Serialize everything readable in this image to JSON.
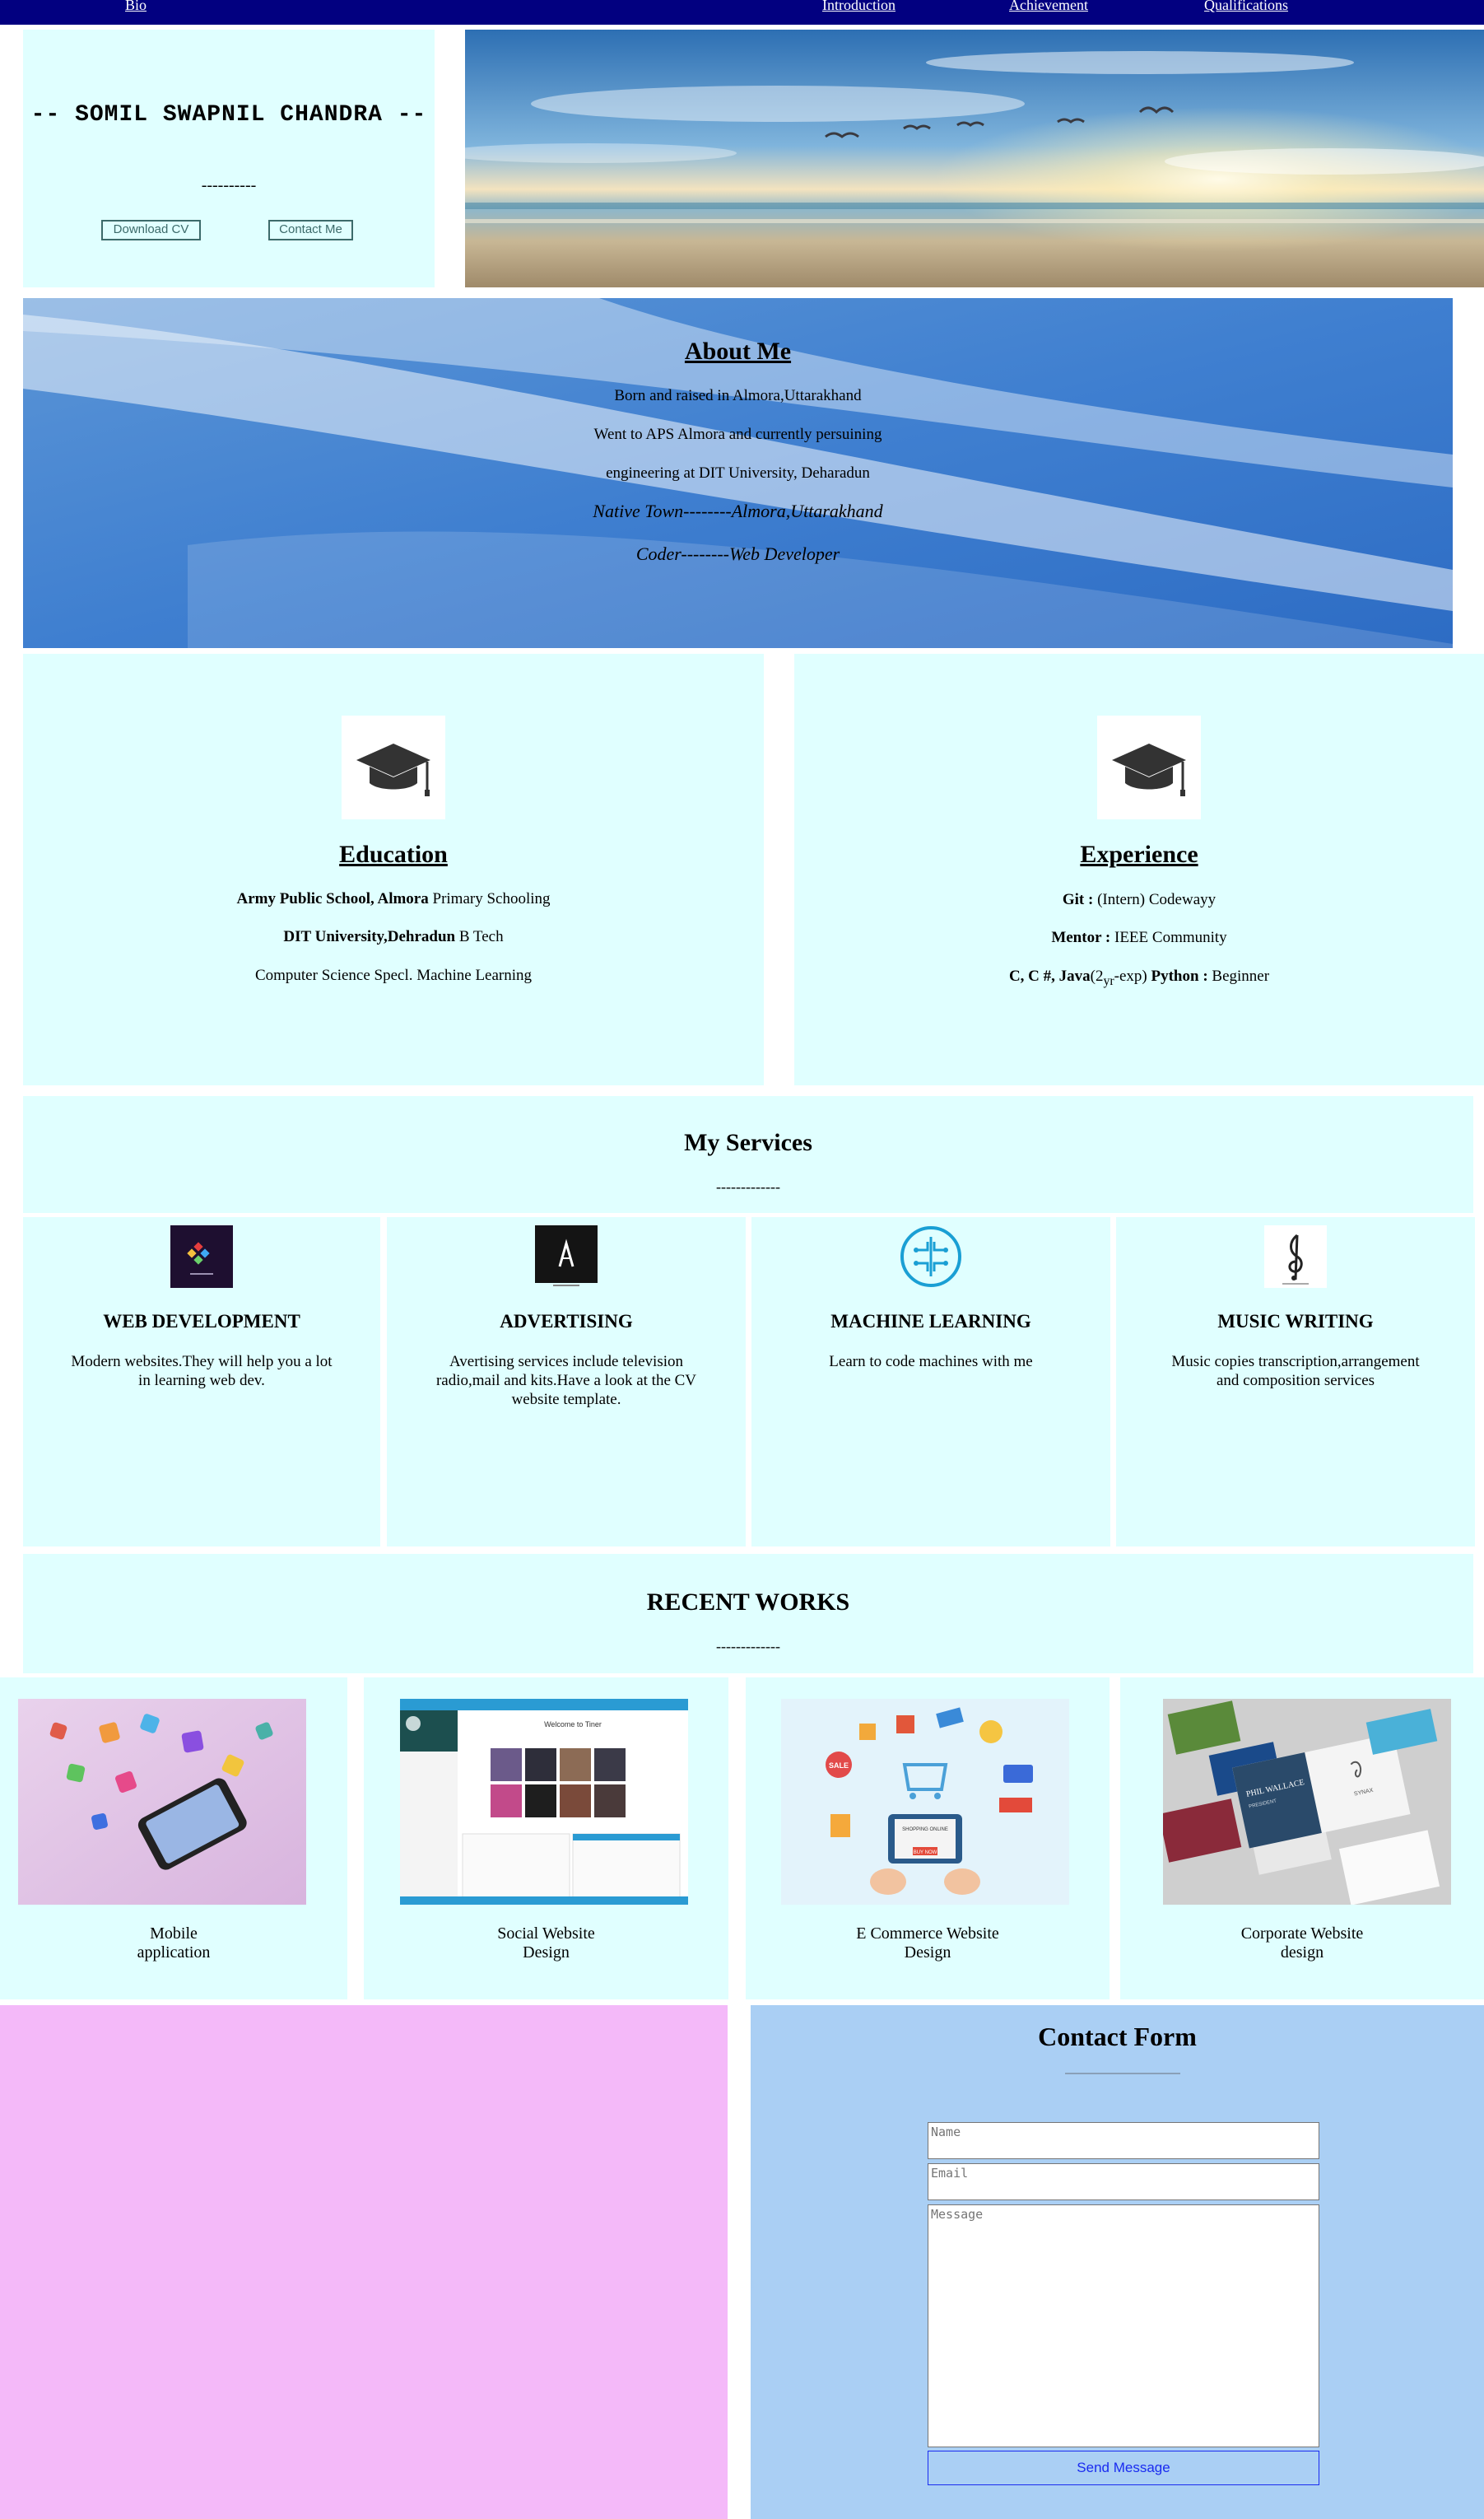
{
  "nav": {
    "bio": "Bio",
    "introduction": "Introduction",
    "achievement": "Achievement",
    "qualifications": "Qualifications"
  },
  "hero": {
    "name": "-- SOMIL SWAPNIL CHANDRA --",
    "dash": "----------",
    "download_cv": "Download CV",
    "contact_me": "Contact Me"
  },
  "about": {
    "title": "About Me",
    "line1": "Born and raised in Almora,Uttarakhand",
    "line2": "Went to APS Almora and currently persuining",
    "line3": "engineering at DIT University, Deharadun",
    "native_label": "Native Town--------",
    "native_value": "Almora,Uttarakhand",
    "coder_label": "Coder--------",
    "coder_value": "Web Developer"
  },
  "education": {
    "title": "Education",
    "school_name": "Army Public School, Almora",
    "school_detail": " Primary Schooling",
    "uni_name": "DIT University,Dehradun",
    "uni_detail": " B Tech",
    "spec": "Computer Science Specl. Machine Learning"
  },
  "experience": {
    "title": "Experience",
    "git_label": "Git :",
    "git_value": " (Intern) Codewayy",
    "mentor_label": "Mentor :",
    "mentor_value": " IEEE Community",
    "lang_label": "C, C #, Java",
    "lang_exp_open": "(2",
    "lang_exp_sub": "yr",
    "lang_exp_close": "-exp) ",
    "python_label": "Python :",
    "python_value": " Beginner"
  },
  "services": {
    "title": "My Services",
    "dash": "-------------",
    "items": [
      {
        "title": "WEB DEVELOPMENT",
        "desc": "Modern websites.They will help you a lot in learning web dev.",
        "icon": "web-dev-logo-icon"
      },
      {
        "title": "ADVERTISING",
        "desc": "Avertising services include television radio,mail and kits.Have a look at the CV website template.",
        "icon": "advertising-logo-icon"
      },
      {
        "title": "MACHINE LEARNING",
        "desc": "Learn to code machines with me",
        "icon": "circuit-brain-icon"
      },
      {
        "title": "MUSIC WRITING",
        "desc": "Music copies transcription,arrangement and composition services",
        "icon": "treble-clef-icon"
      }
    ]
  },
  "works": {
    "title": "RECENT WORKS",
    "dash": "-------------",
    "items": [
      {
        "line1": "Mobile",
        "line2": "application"
      },
      {
        "line1": "Social Website",
        "line2": "Design"
      },
      {
        "line1": "E Commerce Website",
        "line2": "Design"
      },
      {
        "line1": "Corporate Website",
        "line2": "design"
      }
    ],
    "social_header": "Welcome to Tiner",
    "card_name": "PHIL WALLACE",
    "card_role": "PRESIDENT",
    "card_brand": "SYNAX",
    "ecom_sale": "SALE",
    "ecom_shop": "SHOPPING ONLINE",
    "ecom_buy": "BUY NOW"
  },
  "contact": {
    "title": "Contact Form",
    "name_placeholder": "Name",
    "email_placeholder": "Email",
    "message_placeholder": "Message",
    "send": "Send Message"
  },
  "colors": {
    "nav": "#020080",
    "card": "#e0ffff",
    "pink": "#f4b9f9",
    "contact": "#aacff4"
  }
}
